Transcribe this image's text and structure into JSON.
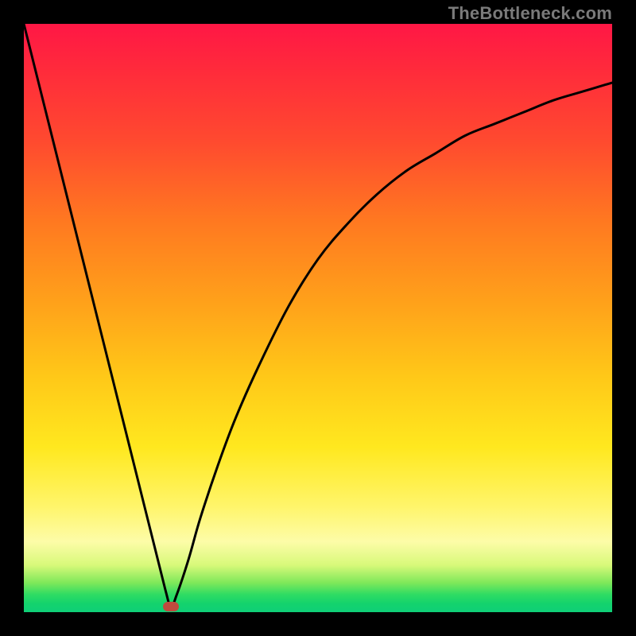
{
  "watermark": "TheBottleneck.com",
  "colors": {
    "frame": "#000000",
    "curve": "#000000",
    "marker": "#c04a3e",
    "gradient_stops": [
      "#ff1745",
      "#ff2b3b",
      "#ff4a2f",
      "#ff7a20",
      "#ffa31a",
      "#ffc818",
      "#ffe81f",
      "#fff56a",
      "#fdfca8",
      "#d8f97a",
      "#7fe85a",
      "#2fdc63",
      "#14d36c",
      "#0fcf78"
    ]
  },
  "chart_data": {
    "type": "line",
    "title": "",
    "xlabel": "",
    "ylabel": "",
    "xlim": [
      0,
      100
    ],
    "ylim": [
      0,
      100
    ],
    "grid": false,
    "legend": false,
    "note": "x and y in percent of plot area; (0,0) bottom-left. Curve is a V with minimum at ~x=25. Left arm linear from top-left to min; right arm rises with decreasing slope toward upper right.",
    "series": [
      {
        "name": "bottleneck-curve",
        "x": [
          0,
          5,
          10,
          15,
          20,
          24,
          25,
          26,
          28,
          30,
          33,
          36,
          40,
          45,
          50,
          55,
          60,
          65,
          70,
          75,
          80,
          85,
          90,
          95,
          100
        ],
        "y": [
          100,
          80,
          60,
          40,
          20,
          4,
          1,
          3,
          9,
          16,
          25,
          33,
          42,
          52,
          60,
          66,
          71,
          75,
          78,
          81,
          83,
          85,
          87,
          88.5,
          90
        ]
      }
    ],
    "marker": {
      "x": 25,
      "y": 1,
      "shape": "pill",
      "color": "#c04a3e"
    }
  }
}
